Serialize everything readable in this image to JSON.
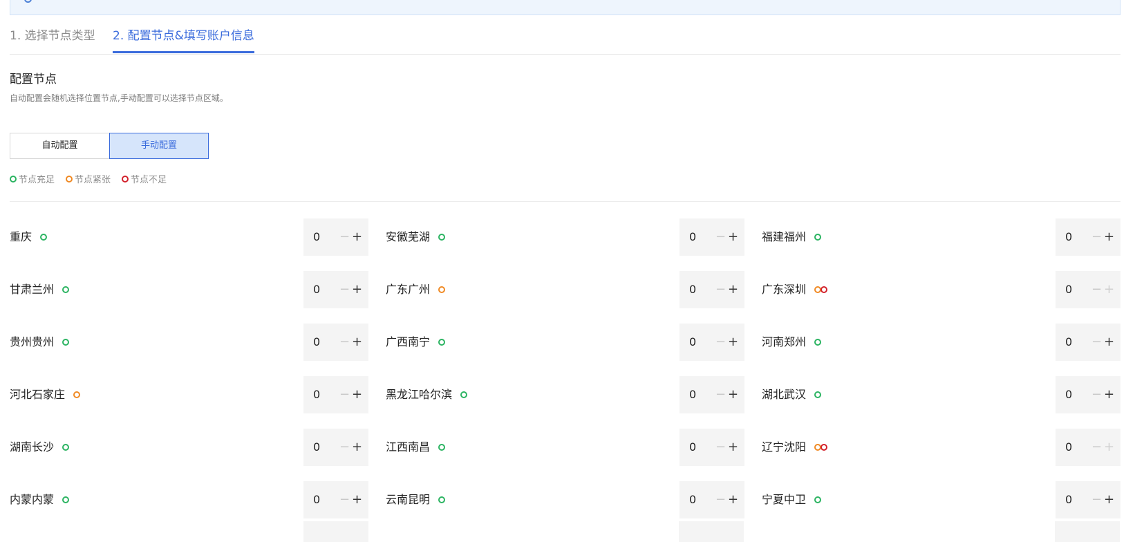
{
  "tabs": [
    {
      "label": "1. 选择节点类型"
    },
    {
      "label": "2. 配置节点&填写账户信息"
    }
  ],
  "config": {
    "title": "配置节点",
    "desc": "自动配置会随机选择位置节点,手动配置可以选择节点区域。",
    "auto_label": "自动配置",
    "manual_label": "手动配置"
  },
  "legend": [
    {
      "label": "节点充足",
      "color": "#2cb462"
    },
    {
      "label": "节点紧张",
      "color": "#f08a24"
    },
    {
      "label": "节点不足",
      "color": "#d3232e"
    }
  ],
  "regions": [
    [
      {
        "name": "重庆",
        "status": [
          "green"
        ],
        "value": "0",
        "plus_enabled": true
      },
      {
        "name": "安徽芜湖",
        "status": [
          "green"
        ],
        "value": "0",
        "plus_enabled": true
      },
      {
        "name": "福建福州",
        "status": [
          "green"
        ],
        "value": "0",
        "plus_enabled": true
      }
    ],
    [
      {
        "name": "甘肃兰州",
        "status": [
          "green"
        ],
        "value": "0",
        "plus_enabled": true
      },
      {
        "name": "广东广州",
        "status": [
          "orange"
        ],
        "value": "0",
        "plus_enabled": true
      },
      {
        "name": "广东深圳",
        "status": [
          "orange",
          "red"
        ],
        "value": "0",
        "plus_enabled": false
      }
    ],
    [
      {
        "name": "贵州贵州",
        "status": [
          "green"
        ],
        "value": "0",
        "plus_enabled": true
      },
      {
        "name": "广西南宁",
        "status": [
          "green"
        ],
        "value": "0",
        "plus_enabled": true
      },
      {
        "name": "河南郑州",
        "status": [
          "green"
        ],
        "value": "0",
        "plus_enabled": true
      }
    ],
    [
      {
        "name": "河北石家庄",
        "status": [
          "orange"
        ],
        "value": "0",
        "plus_enabled": true
      },
      {
        "name": "黑龙江哈尔滨",
        "status": [
          "green"
        ],
        "value": "0",
        "plus_enabled": true
      },
      {
        "name": "湖北武汉",
        "status": [
          "green"
        ],
        "value": "0",
        "plus_enabled": true
      }
    ],
    [
      {
        "name": "湖南长沙",
        "status": [
          "green"
        ],
        "value": "0",
        "plus_enabled": true
      },
      {
        "name": "江西南昌",
        "status": [
          "green"
        ],
        "value": "0",
        "plus_enabled": true
      },
      {
        "name": "辽宁沈阳",
        "status": [
          "orange",
          "red"
        ],
        "value": "0",
        "plus_enabled": false
      }
    ],
    [
      {
        "name": "内蒙内蒙",
        "status": [
          "green"
        ],
        "value": "0",
        "plus_enabled": true
      },
      {
        "name": "云南昆明",
        "status": [
          "green"
        ],
        "value": "0",
        "plus_enabled": true
      },
      {
        "name": "宁夏中卫",
        "status": [
          "green"
        ],
        "value": "0",
        "plus_enabled": true
      }
    ]
  ],
  "stepper": {
    "minus": "−",
    "plus": "+"
  }
}
